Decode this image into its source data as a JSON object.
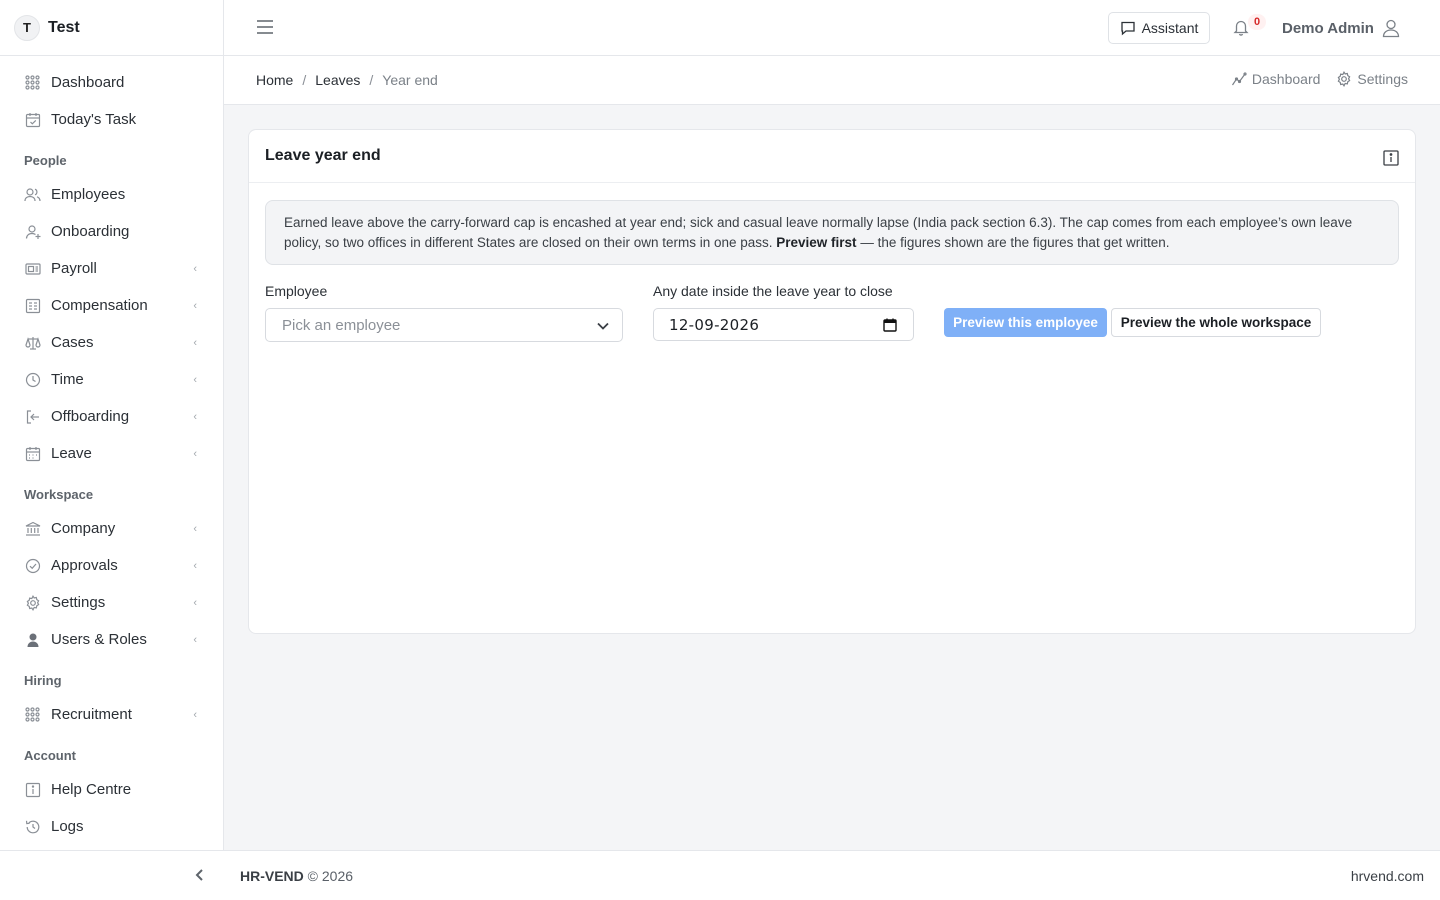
{
  "brand": {
    "initial": "T",
    "name": "Test"
  },
  "nav_top": [
    {
      "label": "Dashboard",
      "icon": "grid-icon"
    },
    {
      "label": "Today's Task",
      "icon": "calendar-check-icon"
    }
  ],
  "sections": {
    "people": "People",
    "workspace": "Workspace",
    "hiring": "Hiring",
    "account": "Account"
  },
  "nav_people": [
    {
      "label": "Employees",
      "icon": "users-icon"
    },
    {
      "label": "Onboarding",
      "icon": "user-plus-icon"
    },
    {
      "label": "Payroll",
      "icon": "payroll-icon",
      "chevron": "‹"
    },
    {
      "label": "Compensation",
      "icon": "compensation-icon",
      "chevron": "‹"
    },
    {
      "label": "Cases",
      "icon": "scale-icon",
      "chevron": "‹"
    },
    {
      "label": "Time",
      "icon": "clock-icon",
      "chevron": "‹"
    },
    {
      "label": "Offboarding",
      "icon": "exit-icon",
      "chevron": "‹"
    },
    {
      "label": "Leave",
      "icon": "calendar-icon",
      "chevron": "‹"
    }
  ],
  "nav_workspace": [
    {
      "label": "Company",
      "icon": "bank-icon",
      "chevron": "‹"
    },
    {
      "label": "Approvals",
      "icon": "check-circle-icon",
      "chevron": "‹"
    },
    {
      "label": "Settings",
      "icon": "gear-icon",
      "chevron": "‹"
    },
    {
      "label": "Users & Roles",
      "icon": "user-shield-icon",
      "chevron": "‹"
    }
  ],
  "nav_hiring": [
    {
      "label": "Recruitment",
      "icon": "grid-icon",
      "chevron": "‹"
    }
  ],
  "nav_account": [
    {
      "label": "Help Centre",
      "icon": "info-icon"
    },
    {
      "label": "Logs",
      "icon": "history-icon"
    }
  ],
  "topbar": {
    "assistant_label": "Assistant",
    "notification_count": "0",
    "user_name": "Demo Admin"
  },
  "breadcrumb": {
    "home": "Home",
    "leaves": "Leaves",
    "current": "Year end",
    "separator": "/",
    "dashboard_link": "Dashboard",
    "settings_link": "Settings"
  },
  "card": {
    "title": "Leave year end",
    "notice_text_1": "Earned leave above the carry-forward cap is encashed at year end; sick and casual leave normally lapse (India pack section 6.3). The cap comes from each employee’s own leave policy, so two offices in different States are closed on their own terms in one pass. ",
    "notice_bold": "Preview first",
    "notice_text_2": " — the figures shown are the figures that get written.",
    "employee_label": "Employee",
    "employee_placeholder": "Pick an employee",
    "date_label": "Any date inside the leave year to close",
    "date_value": "12-09-2026",
    "preview_employee_button": "Preview this employee",
    "preview_workspace_button": "Preview the whole workspace"
  },
  "footer": {
    "brand": "HR-VEND",
    "copyright": "© 2026",
    "link": "hrvend.com"
  },
  "colors": {
    "primary_button": "#7fb0f7",
    "badge_text": "#d62828"
  }
}
